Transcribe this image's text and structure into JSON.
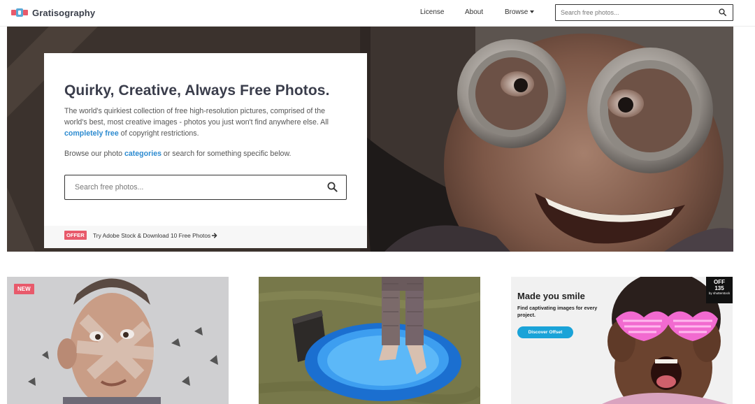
{
  "header": {
    "brand": "Gratisography",
    "nav": {
      "license": "License",
      "about": "About",
      "browse": "Browse"
    },
    "search_placeholder": "Search free photos..."
  },
  "hero": {
    "title": "Quirky, Creative, Always Free Photos.",
    "description_main": "The world's quirkiest collection of free high-resolution pictures, comprised of the world's best, most creative images - photos you just won't find anywhere else. All",
    "description_link": "completely free",
    "description_tail": " of copyright restrictions.",
    "browse_prefix": "Browse our photo ",
    "browse_link": "categories",
    "browse_suffix": " or search for something specific below.",
    "search_placeholder": "Search free photos...",
    "offer_badge": "OFFER",
    "offer_text": "Try Adobe Stock & Download 10 Free Photos"
  },
  "grid": {
    "tile1_badge": "NEW",
    "ad": {
      "title": "Made you smile",
      "subtitle": "Find captivating images for every project.",
      "button": "Discover Offset",
      "logo_line1": "OFF",
      "logo_line2": "135",
      "logo_line3": "by shutterstock"
    }
  },
  "colors": {
    "accent_pink": "#e85a6b",
    "link_blue": "#2d8bd0",
    "ad_button_blue": "#1aa3d8"
  },
  "icons": [
    "logo-icon",
    "search-icon",
    "caret-down-icon",
    "arrow-right-icon"
  ]
}
